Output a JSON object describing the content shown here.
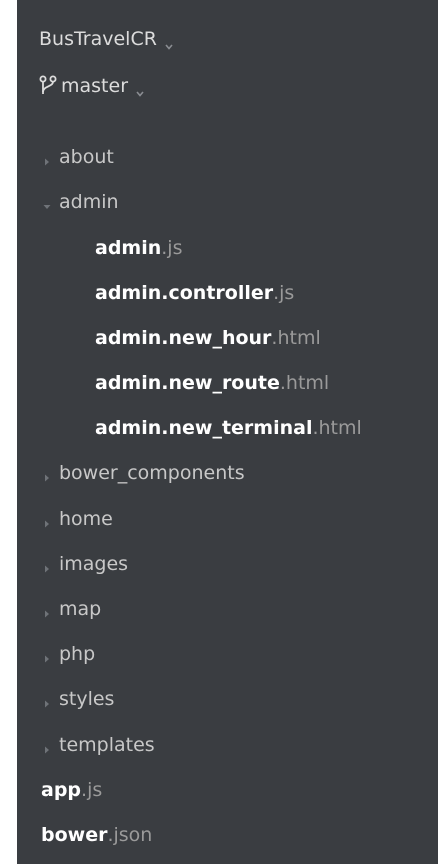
{
  "project": {
    "name": "BusTravelCR",
    "icon": "chevron-down-icon"
  },
  "branch": {
    "name": "master",
    "icon": "git-branch-icon"
  },
  "tree": {
    "folders_top": [
      {
        "label": "about",
        "state": "collapsed"
      },
      {
        "label": "admin",
        "state": "expanded"
      }
    ],
    "admin_files": [
      {
        "base": "admin",
        "ext": ".js"
      },
      {
        "base": "admin.controller",
        "ext": ".js"
      },
      {
        "base": "admin.new_hour",
        "ext": ".html"
      },
      {
        "base": "admin.new_route",
        "ext": ".html"
      },
      {
        "base": "admin.new_terminal",
        "ext": ".html"
      }
    ],
    "folders_bottom": [
      {
        "label": "bower_components",
        "state": "collapsed"
      },
      {
        "label": "home",
        "state": "collapsed"
      },
      {
        "label": "images",
        "state": "collapsed"
      },
      {
        "label": "map",
        "state": "collapsed"
      },
      {
        "label": "php",
        "state": "collapsed"
      },
      {
        "label": "styles",
        "state": "collapsed"
      },
      {
        "label": "templates",
        "state": "collapsed"
      }
    ],
    "root_files": [
      {
        "base": "app",
        "ext": ".js"
      },
      {
        "base": "bower",
        "ext": ".json"
      }
    ]
  },
  "colors": {
    "panel_bg": "#3a3d41",
    "folder_text": "#c8c8c8",
    "file_base": "#ffffff",
    "file_ext": "#9a9a9a",
    "arrow": "#7a7d82"
  }
}
